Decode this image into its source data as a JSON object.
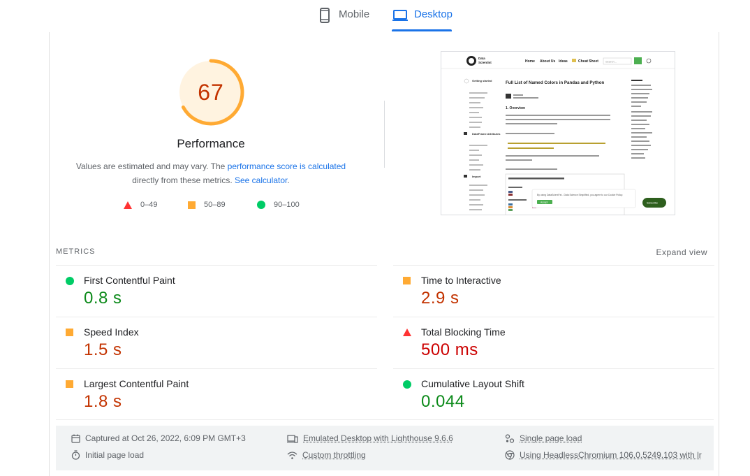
{
  "tabs": {
    "mobile": "Mobile",
    "desktop": "Desktop",
    "active": "Desktop"
  },
  "performance": {
    "score": "67",
    "score_value": 67,
    "title": "Performance",
    "note_prefix": "Values are estimated and may vary. The ",
    "note_link1": "performance score is calculated",
    "note_mid": "directly from these metrics. ",
    "note_link2": "See calculator",
    "note_suffix": ".",
    "legend": {
      "fail": "0–49",
      "average": "50–89",
      "pass": "90–100"
    },
    "colors": {
      "fail": "#ff3333",
      "average": "#ffaa33",
      "pass": "#00cc66",
      "gauge_track": "#fff3e0"
    }
  },
  "screenshot": {
    "site_name_1": "Data",
    "site_name_2": "Scientist",
    "nav": [
      "Home",
      "About Us",
      "Ideas",
      "Cheat Sheet"
    ],
    "search_placeholder": "Search...",
    "article_title": "Full List of Named Colors in Pandas and Python",
    "section_heading": "1. Overview",
    "cookie_text": "By using DataScientYst - Data Science Simplified, you agree to our Cookie Policy.",
    "accept": "Accept",
    "subscribe": "Subscribe",
    "sidebar_groups": [
      "Getting started",
      "DataFrame Attributes",
      "Import"
    ]
  },
  "metrics": {
    "heading": "METRICS",
    "expand": "Expand view",
    "items": [
      {
        "title": "First Contentful Paint",
        "value": "0.8 s",
        "status": "pass"
      },
      {
        "title": "Time to Interactive",
        "value": "2.9 s",
        "status": "average"
      },
      {
        "title": "Speed Index",
        "value": "1.5 s",
        "status": "average"
      },
      {
        "title": "Total Blocking Time",
        "value": "500 ms",
        "status": "fail"
      },
      {
        "title": "Largest Contentful Paint",
        "value": "1.8 s",
        "status": "average"
      },
      {
        "title": "Cumulative Layout Shift",
        "value": "0.044",
        "status": "pass"
      }
    ]
  },
  "runtime": {
    "captured": "Captured at Oct 26, 2022, 6:09 PM GMT+3",
    "initial_load": "Initial page load",
    "emulated": "Emulated Desktop with Lighthouse 9.6.6",
    "throttling": "Custom throttling",
    "single_load": "Single page load",
    "browser": "Using HeadlessChromium 106.0.5249.103 with lr"
  }
}
